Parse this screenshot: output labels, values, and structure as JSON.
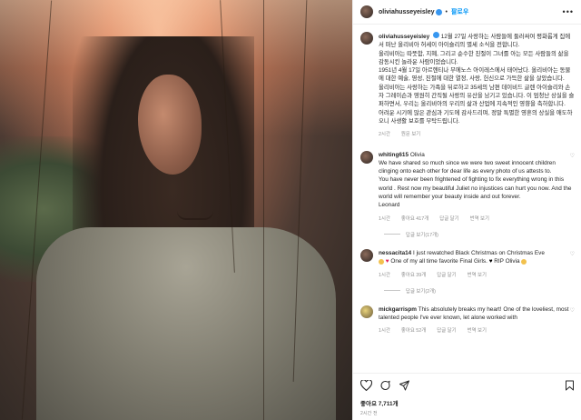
{
  "header": {
    "username": "oliviahusseyeisley",
    "follow_label": "팔로우",
    "more_label": "•••"
  },
  "caption": {
    "username": "oliviahusseyeisley",
    "paragraphs": [
      "12월 27일 사랑하는 사람들에 둘러싸여 평화롭게 집에서 떠난 올리비아 허세이 아이슬리의 별세 소식을 전합니다.",
      "올리비아는 따뜻함, 지혜, 그리고 순수한 친절이 그녀를 아는 모든 사람들의 삶을 감동시킨 놀라운 사람이었습니다.",
      "1951년 4월 17일 아르헨티나 부에노스 아이레스에서 태어났다. 올리비아는 동물에 대한 예술, 영성, 친절에 대한 열정, 사랑, 헌신으로 가득한 삶을 살았습니다.",
      "올리비아는 사랑하는 가족을 뒤로하고 35세의 남편 데이비드 글렌 아이슬리와 손자 그레이슨과 영원히 간직될 사랑의 유산을 남기고 있습니다. 이 엄청난 상실을 슬퍼하면서, 우리는 올리비아의 우리의 삶과 산업에 지속적인 영향을 축하합니다.",
      "어려운 시기에 많은 관심과 기도에 감사드리며, 정말 특별한 영혼의 상실을 애도하오니 사생활 보호를 부탁드립니다."
    ],
    "time": "2시간",
    "translate": "원문 보기"
  },
  "comments": [
    {
      "username": "whiting615",
      "name_suffix": "Olivia",
      "text": "We have shared so much since we were two sweet innocent children clinging onto each other for dear life as every photo of us attests to.",
      "text2": "You have never been frightened of fighting to fix everything wrong in this world . Rest now my beautiful Juliet no injustices can hurt you now. And the world will remember your beauty inside and out forever.",
      "text3": "Leonard",
      "time": "1시간",
      "likes": "좋아요 417개",
      "reply": "답글 달기",
      "translate": "번역 보기",
      "replies": "답글 보기(17개)"
    },
    {
      "username": "nessacita14",
      "text": "I just rewatched Black Christmas on Christmas Eve",
      "text2": "One of my all time favorite Final Girls.",
      "text3": "RIP Olivia",
      "time": "1시간",
      "likes": "좋아요 39개",
      "reply": "답글 달기",
      "translate": "번역 보기",
      "replies": "답글 보기(2개)"
    },
    {
      "username": "mickgarrispm",
      "text": "This absolutely breaks my heart! One of the loveliest, most talented people I've ever known, let alone worked with",
      "time": "1시간",
      "likes": "좋아요 52개",
      "reply": "답글 달기",
      "translate": "번역 보기"
    }
  ],
  "footer": {
    "likes": "좋아요 7,711개",
    "time": "2시간 전"
  },
  "colors": {
    "accent": "#0095f6",
    "verified": "#3897f0",
    "muted": "#8e8e8e"
  }
}
